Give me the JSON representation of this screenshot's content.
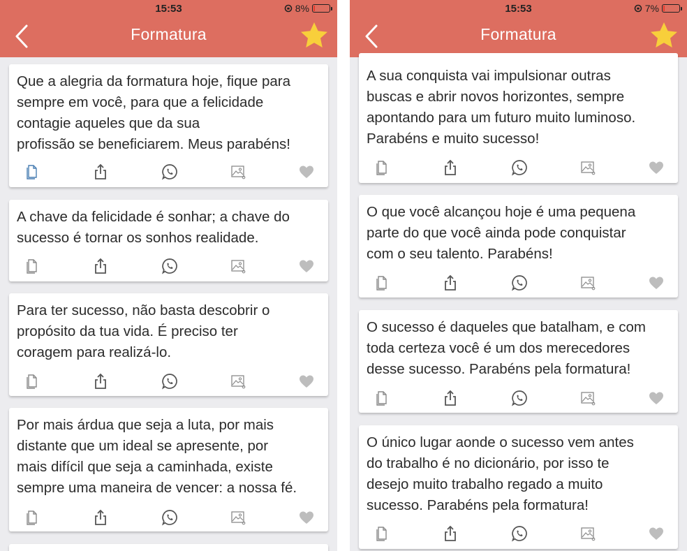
{
  "status": {
    "time": "15:53",
    "left_battery": "8%",
    "right_battery": "7%"
  },
  "header": {
    "title": "Formatura",
    "back_icon": "chevron-left-icon",
    "favorite_icon": "star-icon",
    "color": "#dd6e60",
    "star_color": "#f8cf3b"
  },
  "left_cards": [
    {
      "lines": [
        "Que a alegria da formatura hoje, fique para",
        "sempre em você, para que a felicidade",
        "contagie aqueles que da sua",
        "profissão se beneficiarem. Meus parabéns!"
      ]
    },
    {
      "lines": [
        "A chave da felicidade é sonhar; a chave do",
        "sucesso é tornar os sonhos realidade."
      ]
    },
    {
      "lines": [
        "Para ter sucesso, não basta descobrir o",
        "propósito da tua vida. É preciso ter",
        "coragem para realizá-lo."
      ]
    },
    {
      "lines": [
        "Por mais árdua que seja a luta, por mais",
        "distante que um ideal se apresente, por",
        "mais difícil que seja a caminhada, existe",
        "sempre uma maneira de vencer: a nossa fé."
      ]
    }
  ],
  "right_cards": [
    {
      "lines": [
        "A sua conquista vai impulsionar outras",
        "buscas e abrir novos horizontes, sempre",
        "apontando para um futuro muito luminoso.",
        "Parabéns e muito sucesso!"
      ]
    },
    {
      "lines": [
        "O que você alcançou hoje é uma pequena",
        "parte do que você ainda pode conquistar",
        "com o seu talento. Parabéns!"
      ]
    },
    {
      "lines": [
        "O sucesso é daqueles que batalham, e com",
        "toda certeza você é um dos merecedores",
        "desse sucesso. Parabéns pela formatura!"
      ]
    },
    {
      "lines": [
        "O único lugar aonde o sucesso vem antes",
        "do trabalho é no dicionário, por isso te",
        "desejo muito trabalho regado a muito",
        "sucesso. Parabéns pela formatura!"
      ]
    }
  ],
  "card_actions": [
    "copy-icon",
    "share-icon",
    "whatsapp-icon",
    "image-icon",
    "heart-icon"
  ]
}
